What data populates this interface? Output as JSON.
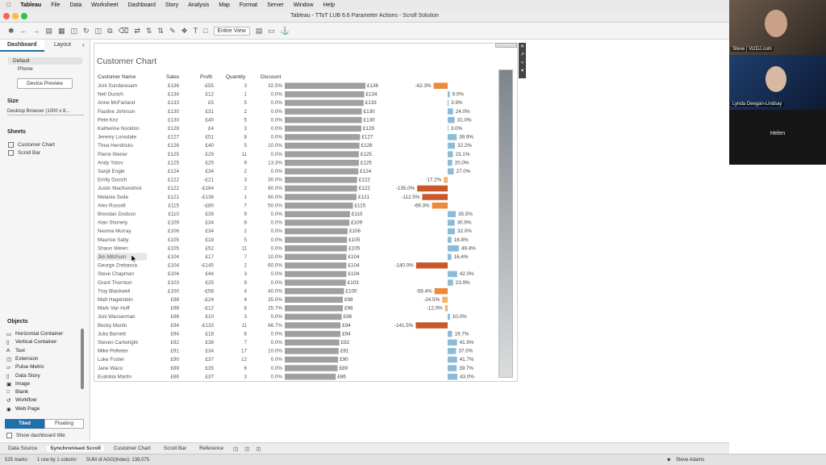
{
  "menubar": {
    "app": "Tableau",
    "items": [
      "File",
      "Data",
      "Worksheet",
      "Dashboard",
      "Story",
      "Analysis",
      "Map",
      "Format",
      "Server",
      "Window",
      "Help"
    ]
  },
  "window": {
    "title": "Tableau - TToT LUB 6.6 Parameter Actions - Scroll Solution"
  },
  "toolbar": {
    "view_select": "Entire View"
  },
  "leftpane": {
    "tabs": {
      "dashboard": "Dashboard",
      "layout": "Layout"
    },
    "device_options": [
      "Default",
      "Phone"
    ],
    "device_preview": "Device Preview",
    "size_label": "Size",
    "size_value": "Desktop Browser (1000 x 8...",
    "sheets_label": "Sheets",
    "sheets": [
      "Customer Chart",
      "Scroll Bar"
    ],
    "objects_label": "Objects",
    "objects": [
      "Horizontal Container",
      "Vertical Container",
      "Text",
      "Extension",
      "Pulse Metric",
      "Data Story",
      "Image",
      "Blank",
      "Workflow",
      "Web Page"
    ],
    "tiled": "Tiled",
    "floating": "Floating",
    "show_title": "Show dashboard title"
  },
  "bottom_tabs": [
    "Data Source",
    "Synchronised Scroll",
    "Customer Chart",
    "Scroll Bar",
    "Reference"
  ],
  "status": {
    "marks": "525 marks",
    "rows": "1 row by 1 column",
    "sum": "SUM of AGG(Index): 138,075",
    "user": "Steve Adams"
  },
  "video": {
    "p1": "Steve | VizDJ.com",
    "p2": "Lynda Deegan-Lindsay",
    "p3": "Helen"
  },
  "colors": {
    "sales_bar": "#a0a0a0",
    "pos_disc": "#8dbbd7",
    "neg_light": "#f3b46f",
    "neg_mid": "#ec8a3b",
    "neg_dark": "#c8582a"
  },
  "chart_data": {
    "type": "table",
    "title": "Customer Chart",
    "columns": [
      "Customer Name",
      "Sales",
      "Profit",
      "Quantity",
      "Discount"
    ],
    "rows": [
      {
        "name": "Joni Sundaresam",
        "sales": "£136",
        "profit": "-£55",
        "qty": "3",
        "disc": "32.5%",
        "sv": 136,
        "pct": -62.3,
        "pct_label": "-62.3%"
      },
      {
        "name": "Neil Ducich",
        "sales": "£134",
        "profit": "£12",
        "qty": "1",
        "disc": "0.0%",
        "sv": 134,
        "pct": 9.0,
        "pct_label": "9.0%"
      },
      {
        "name": "Anne McFarland",
        "sales": "£133",
        "profit": "£5",
        "qty": "5",
        "disc": "0.0%",
        "sv": 133,
        "pct": 3.9,
        "pct_label": "3.9%"
      },
      {
        "name": "Pauline Johnson",
        "sales": "£130",
        "profit": "£31",
        "qty": "2",
        "disc": "0.0%",
        "sv": 130,
        "pct": 24.0,
        "pct_label": "24.0%"
      },
      {
        "name": "Pete Kriz",
        "sales": "£130",
        "profit": "£40",
        "qty": "5",
        "disc": "0.0%",
        "sv": 130,
        "pct": 31.0,
        "pct_label": "31.0%"
      },
      {
        "name": "Katherine Nockton",
        "sales": "£129",
        "profit": "£4",
        "qty": "3",
        "disc": "0.0%",
        "sv": 129,
        "pct": 3.0,
        "pct_label": "3.0%"
      },
      {
        "name": "Jeremy Lonsdale",
        "sales": "£127",
        "profit": "£51",
        "qty": "8",
        "disc": "0.0%",
        "sv": 127,
        "pct": 39.9,
        "pct_label": "39.9%"
      },
      {
        "name": "Thea Hendricks",
        "sales": "£126",
        "profit": "£40",
        "qty": "5",
        "disc": "10.0%",
        "sv": 126,
        "pct": 32.2,
        "pct_label": "32.2%"
      },
      {
        "name": "Pierre Wener",
        "sales": "£125",
        "profit": "£29",
        "qty": "11",
        "disc": "0.0%",
        "sv": 125,
        "pct": 23.1,
        "pct_label": "23.1%"
      },
      {
        "name": "Andy Yotov",
        "sales": "£125",
        "profit": "£25",
        "qty": "9",
        "disc": "13.3%",
        "sv": 125,
        "pct": 20.0,
        "pct_label": "20.0%"
      },
      {
        "name": "Sanjit Engle",
        "sales": "£124",
        "profit": "£34",
        "qty": "2",
        "disc": "0.0%",
        "sv": 124,
        "pct": 27.0,
        "pct_label": "27.0%"
      },
      {
        "name": "Emily Ducich",
        "sales": "£122",
        "profit": "-£21",
        "qty": "3",
        "disc": "30.0%",
        "sv": 122,
        "pct": -17.2,
        "pct_label": "-17.2%"
      },
      {
        "name": "Justin MacKendrick",
        "sales": "£122",
        "profit": "-£164",
        "qty": "2",
        "disc": "60.0%",
        "sv": 122,
        "pct": -135.0,
        "pct_label": "-135.0%"
      },
      {
        "name": "Melanie Seite",
        "sales": "£121",
        "profit": "-£136",
        "qty": "1",
        "disc": "60.0%",
        "sv": 121,
        "pct": -112.5,
        "pct_label": "-112.5%"
      },
      {
        "name": "Alex Russell",
        "sales": "£115",
        "profit": "-£80",
        "qty": "7",
        "disc": "50.0%",
        "sv": 115,
        "pct": -69.3,
        "pct_label": "-69.3%"
      },
      {
        "name": "Brendan Dodson",
        "sales": "£110",
        "profit": "£39",
        "qty": "9",
        "disc": "0.0%",
        "sv": 110,
        "pct": 35.5,
        "pct_label": "35.5%"
      },
      {
        "name": "Alan Shonely",
        "sales": "£109",
        "profit": "£34",
        "qty": "8",
        "disc": "0.0%",
        "sv": 109,
        "pct": 30.9,
        "pct_label": "30.9%"
      },
      {
        "name": "Neoma Murray",
        "sales": "£106",
        "profit": "£34",
        "qty": "2",
        "disc": "0.0%",
        "sv": 106,
        "pct": 32.0,
        "pct_label": "32.0%"
      },
      {
        "name": "Maurice Satty",
        "sales": "£105",
        "profit": "£18",
        "qty": "5",
        "disc": "0.0%",
        "sv": 105,
        "pct": 16.8,
        "pct_label": "16.8%"
      },
      {
        "name": "Shaun Weien",
        "sales": "£105",
        "profit": "£52",
        "qty": "11",
        "disc": "0.0%",
        "sv": 105,
        "pct": 49.4,
        "pct_label": "49.4%"
      },
      {
        "name": "Jim Mitchum",
        "sales": "£104",
        "profit": "£17",
        "qty": "7",
        "disc": "10.0%",
        "sv": 104,
        "pct": 16.4,
        "pct_label": "16.4%"
      },
      {
        "name": "George Zrebassa",
        "sales": "£104",
        "profit": "-£145",
        "qty": "2",
        "disc": "60.0%",
        "sv": 104,
        "pct": -140.0,
        "pct_label": "-140.0%"
      },
      {
        "name": "Steve Chapman",
        "sales": "£104",
        "profit": "£44",
        "qty": "3",
        "disc": "0.0%",
        "sv": 104,
        "pct": 42.0,
        "pct_label": "42.0%"
      },
      {
        "name": "Grant Thornton",
        "sales": "£103",
        "profit": "£25",
        "qty": "9",
        "disc": "0.0%",
        "sv": 103,
        "pct": 23.9,
        "pct_label": "23.9%"
      },
      {
        "name": "Troy Blackwell",
        "sales": "£100",
        "profit": "-£58",
        "qty": "4",
        "disc": "40.0%",
        "sv": 100,
        "pct": -58.4,
        "pct_label": "-58.4%"
      },
      {
        "name": "Matt Hagelstein",
        "sales": "£98",
        "profit": "-£24",
        "qty": "4",
        "disc": "35.0%",
        "sv": 98,
        "pct": -24.5,
        "pct_label": "-24.5%"
      },
      {
        "name": "Mark Van Huff",
        "sales": "£98",
        "profit": "-£12",
        "qty": "8",
        "disc": "25.7%",
        "sv": 98,
        "pct": -12.0,
        "pct_label": "-12.0%"
      },
      {
        "name": "Joni Wasserman",
        "sales": "£96",
        "profit": "£10",
        "qty": "3",
        "disc": "0.0%",
        "sv": 96,
        "pct": 10.0,
        "pct_label": "10.0%"
      },
      {
        "name": "Becky Martin",
        "sales": "£94",
        "profit": "-£133",
        "qty": "11",
        "disc": "66.7%",
        "sv": 94,
        "pct": -141.5,
        "pct_label": "-141.5%"
      },
      {
        "name": "Julia Barnett",
        "sales": "£94",
        "profit": "£18",
        "qty": "6",
        "disc": "0.0%",
        "sv": 94,
        "pct": 19.7,
        "pct_label": "19.7%"
      },
      {
        "name": "Steven Cartwright",
        "sales": "£92",
        "profit": "£38",
        "qty": "7",
        "disc": "0.0%",
        "sv": 92,
        "pct": 41.6,
        "pct_label": "41.6%"
      },
      {
        "name": "Mike Pelletier",
        "sales": "£91",
        "profit": "£34",
        "qty": "17",
        "disc": "10.0%",
        "sv": 91,
        "pct": 37.0,
        "pct_label": "37.0%"
      },
      {
        "name": "Luke Foster",
        "sales": "£90",
        "profit": "£37",
        "qty": "12",
        "disc": "0.0%",
        "sv": 90,
        "pct": 41.7,
        "pct_label": "41.7%"
      },
      {
        "name": "Jane Waco",
        "sales": "£89",
        "profit": "£35",
        "qty": "6",
        "disc": "0.0%",
        "sv": 89,
        "pct": 39.7,
        "pct_label": "39.7%"
      },
      {
        "name": "Eudokia Martin",
        "sales": "£86",
        "profit": "£37",
        "qty": "3",
        "disc": "0.0%",
        "sv": 86,
        "pct": 43.0,
        "pct_label": "43.0%"
      }
    ]
  }
}
